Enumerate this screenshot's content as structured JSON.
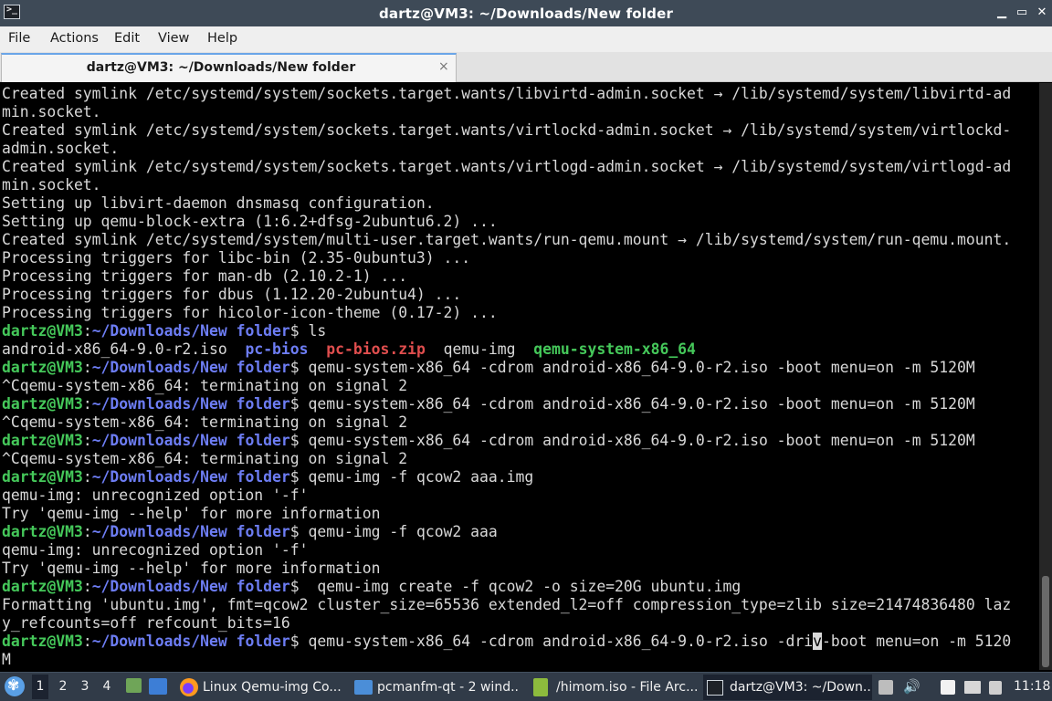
{
  "window": {
    "title": "dartz@VM3: ~/Downloads/New folder",
    "min_glyph": "▁",
    "max_glyph": "▭",
    "close_glyph": "✕"
  },
  "menu": [
    "File",
    "Actions",
    "Edit",
    "View",
    "Help"
  ],
  "tab": {
    "label": "dartz@VM3: ~/Downloads/New folder",
    "close_glyph": "×"
  },
  "terminal": {
    "prompt_user": "dartz@VM3",
    "prompt_sep": ":",
    "prompt_path": "~/Downloads/New folder",
    "prompt_dollar": "$",
    "colors": {
      "text": "#d8d8d8",
      "user": "#45c85a",
      "path": "#6d7df4",
      "zip": "#e04e4e"
    },
    "lines": [
      {
        "t": "out",
        "text": "Created symlink /etc/systemd/system/sockets.target.wants/libvirtd-admin.socket → /lib/systemd/system/libvirtd-ad"
      },
      {
        "t": "out",
        "text": "min.socket."
      },
      {
        "t": "out",
        "text": "Created symlink /etc/systemd/system/sockets.target.wants/virtlockd-admin.socket → /lib/systemd/system/virtlockd-"
      },
      {
        "t": "out",
        "text": "admin.socket."
      },
      {
        "t": "out",
        "text": "Created symlink /etc/systemd/system/sockets.target.wants/virtlogd-admin.socket → /lib/systemd/system/virtlogd-ad"
      },
      {
        "t": "out",
        "text": "min.socket."
      },
      {
        "t": "out",
        "text": "Setting up libvirt-daemon dnsmasq configuration."
      },
      {
        "t": "out",
        "text": "Setting up qemu-block-extra (1:6.2+dfsg-2ubuntu6.2) ..."
      },
      {
        "t": "out",
        "text": "Created symlink /etc/systemd/system/multi-user.target.wants/run-qemu.mount → /lib/systemd/system/run-qemu.mount."
      },
      {
        "t": "out",
        "text": "Processing triggers for libc-bin (2.35-0ubuntu3) ..."
      },
      {
        "t": "out",
        "text": "Processing triggers for man-db (2.10.2-1) ..."
      },
      {
        "t": "out",
        "text": "Processing triggers for dbus (1.12.20-2ubuntu4) ..."
      },
      {
        "t": "out",
        "text": "Processing triggers for hicolor-icon-theme (0.17-2) ..."
      },
      {
        "t": "cmd",
        "cmd": " ls"
      },
      {
        "t": "ls",
        "items": [
          {
            "name": "android-x86_64-9.0-r2.iso",
            "kind": "file"
          },
          {
            "name": "pc-bios",
            "kind": "dir"
          },
          {
            "name": "pc-bios.zip",
            "kind": "zip"
          },
          {
            "name": "qemu-img",
            "kind": "file"
          },
          {
            "name": "qemu-system-x86_64",
            "kind": "exe"
          }
        ]
      },
      {
        "t": "cmd",
        "cmd": " qemu-system-x86_64 -cdrom android-x86_64-9.0-r2.iso -boot menu=on -m 5120M"
      },
      {
        "t": "out",
        "text": "^Cqemu-system-x86_64: terminating on signal 2"
      },
      {
        "t": "cmd",
        "cmd": " qemu-system-x86_64 -cdrom android-x86_64-9.0-r2.iso -boot menu=on -m 5120M"
      },
      {
        "t": "out",
        "text": "^Cqemu-system-x86_64: terminating on signal 2"
      },
      {
        "t": "cmd",
        "cmd": " qemu-system-x86_64 -cdrom android-x86_64-9.0-r2.iso -boot menu=on -m 5120M"
      },
      {
        "t": "out",
        "text": "^Cqemu-system-x86_64: terminating on signal 2"
      },
      {
        "t": "cmd",
        "cmd": " qemu-img -f qcow2 aaa.img"
      },
      {
        "t": "out",
        "text": "qemu-img: unrecognized option '-f'"
      },
      {
        "t": "out",
        "text": "Try 'qemu-img --help' for more information"
      },
      {
        "t": "cmd",
        "cmd": " qemu-img -f qcow2 aaa"
      },
      {
        "t": "out",
        "text": "qemu-img: unrecognized option '-f'"
      },
      {
        "t": "out",
        "text": "Try 'qemu-img --help' for more information"
      },
      {
        "t": "cmd",
        "cmd": "  qemu-img create -f qcow2 -o size=20G ubuntu.img"
      },
      {
        "t": "out",
        "text": "Formatting 'ubuntu.img', fmt=qcow2 cluster_size=65536 extended_l2=off compression_type=zlib size=21474836480 laz"
      },
      {
        "t": "out",
        "text": "y_refcounts=off refcount_bits=16"
      },
      {
        "t": "cmd",
        "cmd": " qemu-system-x86_64 -cdrom android-x86_64-9.0-r2.iso -dri",
        "cursor": "v",
        "after": "-boot menu=on -m 5120"
      },
      {
        "t": "out",
        "text": "M"
      }
    ]
  },
  "taskbar": {
    "workspaces": [
      "1",
      "2",
      "3",
      "4"
    ],
    "active_workspace": "1",
    "tasks": [
      {
        "label": "Linux Qemu-img Co...",
        "icon": "firefox-icon"
      },
      {
        "label": "pcmanfm-qt - 2 wind...",
        "icon": "folder-icon"
      },
      {
        "label": "/himom.iso - File Arc...",
        "icon": "archive-icon"
      },
      {
        "label": "dartz@VM3: ~/Down...",
        "icon": "terminal-icon"
      }
    ],
    "clock": "11:18",
    "volume_glyph": "🔊"
  }
}
